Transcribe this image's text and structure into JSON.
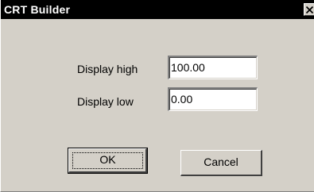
{
  "window": {
    "title": "CRT Builder"
  },
  "icons": {
    "close": "close-icon"
  },
  "form": {
    "display_high": {
      "label": "Display high",
      "value": "100.00"
    },
    "display_low": {
      "label": "Display low",
      "value": "0.00"
    }
  },
  "buttons": {
    "ok": "OK",
    "cancel": "Cancel"
  }
}
